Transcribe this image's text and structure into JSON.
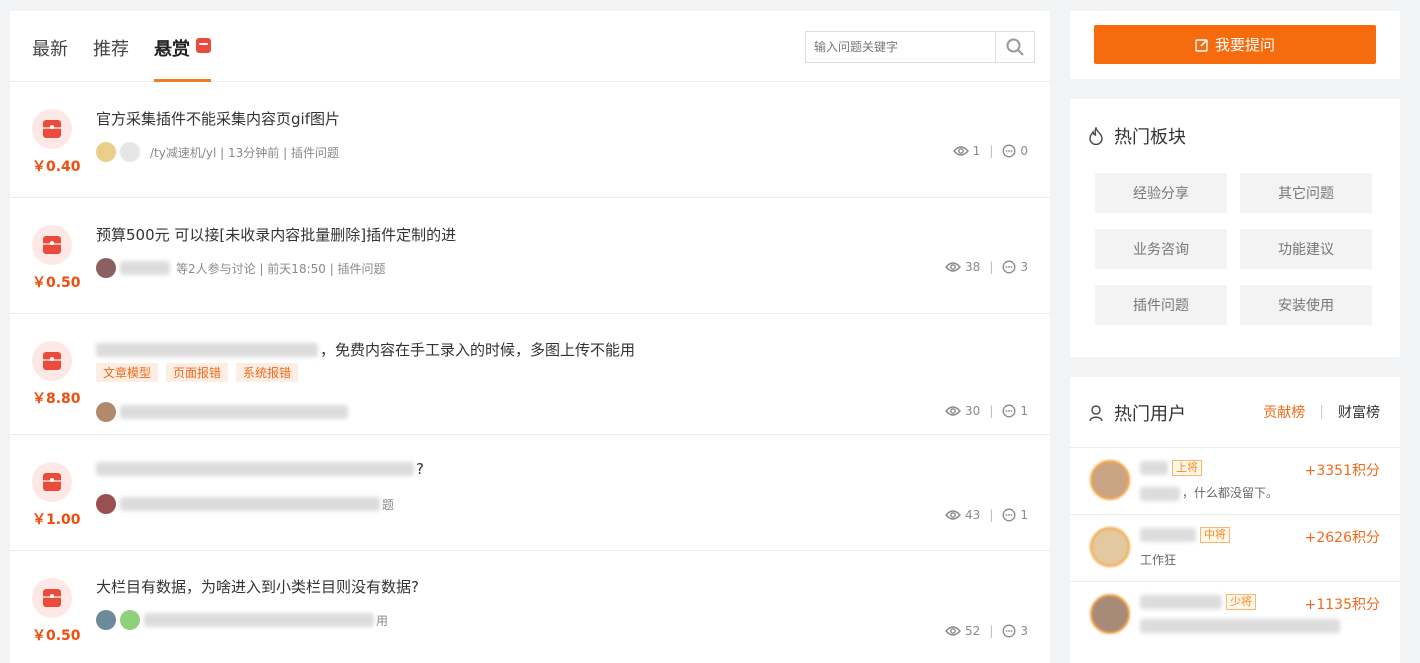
{
  "tabs": [
    {
      "label": "最新"
    },
    {
      "label": "推荐"
    },
    {
      "label": "悬赏"
    }
  ],
  "search": {
    "placeholder": "输入问题关键字"
  },
  "questions": [
    {
      "reward": "￥0.40",
      "title": "官方采集插件不能采集内容页gif图片",
      "meta": "/ty减速机/yl | 13分钟前 | 插件问题",
      "views": "1",
      "comments": "0"
    },
    {
      "reward": "￥0.50",
      "title": "预算500元 可以接[未收录内容批量删除]插件定制的进",
      "meta": "等2人参与讨论 | 前天18:50 | 插件问题",
      "views": "38",
      "comments": "3"
    },
    {
      "reward": "￥8.80",
      "title": "，免费内容在手工录入的时候，多图上传不能用",
      "tags": [
        "文章模型",
        "页面报错",
        "系统报错"
      ],
      "views": "30",
      "comments": "1"
    },
    {
      "reward": "￥1.00",
      "title": "?",
      "meta": "题",
      "views": "43",
      "comments": "1"
    },
    {
      "reward": "￥0.50",
      "title": "大栏目有数据，为啥进入到小类栏目则没有数据?",
      "meta": "用",
      "views": "52",
      "comments": "3"
    }
  ],
  "sidebar": {
    "ask_label": "我要提问",
    "boards_title": "热门板块",
    "boards": [
      "经验分享",
      "其它问题",
      "业务咨询",
      "功能建议",
      "插件问题",
      "安装使用"
    ],
    "users_title": "热门用户",
    "rank_tabs": {
      "contrib": "贡献榜",
      "wealth": "财富榜"
    },
    "users": [
      {
        "rank": "上将",
        "desc": "，什么都没留下。",
        "score": "+3351积分"
      },
      {
        "rank": "中将",
        "desc": "工作狂",
        "score": "+2626积分"
      },
      {
        "rank": "少将",
        "desc": "",
        "score": "+1135积分"
      }
    ]
  },
  "colors": {
    "accent": "#f76b0f",
    "reward": "#ee4d0d",
    "envelope": "#ea4b3d"
  }
}
